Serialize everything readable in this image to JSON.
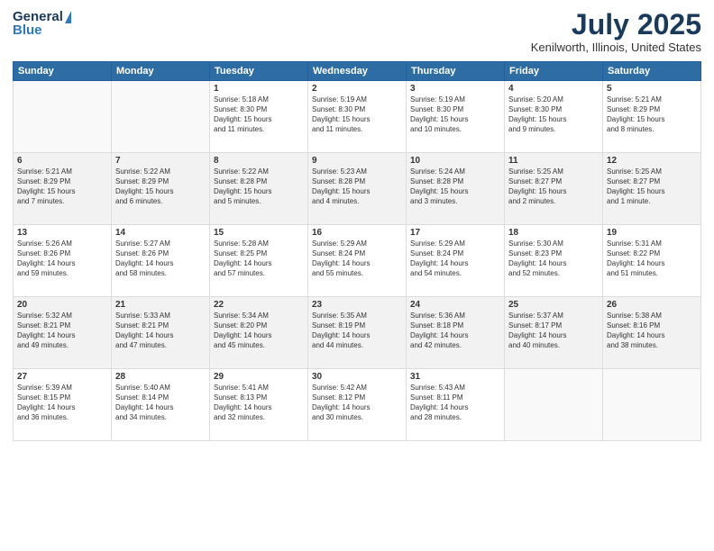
{
  "header": {
    "logo_line1": "General",
    "logo_line2": "Blue",
    "title": "July 2025",
    "subtitle": "Kenilworth, Illinois, United States"
  },
  "weekdays": [
    "Sunday",
    "Monday",
    "Tuesday",
    "Wednesday",
    "Thursday",
    "Friday",
    "Saturday"
  ],
  "weeks": [
    [
      {
        "day": "",
        "content": ""
      },
      {
        "day": "",
        "content": ""
      },
      {
        "day": "1",
        "content": "Sunrise: 5:18 AM\nSunset: 8:30 PM\nDaylight: 15 hours\nand 11 minutes."
      },
      {
        "day": "2",
        "content": "Sunrise: 5:19 AM\nSunset: 8:30 PM\nDaylight: 15 hours\nand 11 minutes."
      },
      {
        "day": "3",
        "content": "Sunrise: 5:19 AM\nSunset: 8:30 PM\nDaylight: 15 hours\nand 10 minutes."
      },
      {
        "day": "4",
        "content": "Sunrise: 5:20 AM\nSunset: 8:30 PM\nDaylight: 15 hours\nand 9 minutes."
      },
      {
        "day": "5",
        "content": "Sunrise: 5:21 AM\nSunset: 8:29 PM\nDaylight: 15 hours\nand 8 minutes."
      }
    ],
    [
      {
        "day": "6",
        "content": "Sunrise: 5:21 AM\nSunset: 8:29 PM\nDaylight: 15 hours\nand 7 minutes."
      },
      {
        "day": "7",
        "content": "Sunrise: 5:22 AM\nSunset: 8:29 PM\nDaylight: 15 hours\nand 6 minutes."
      },
      {
        "day": "8",
        "content": "Sunrise: 5:22 AM\nSunset: 8:28 PM\nDaylight: 15 hours\nand 5 minutes."
      },
      {
        "day": "9",
        "content": "Sunrise: 5:23 AM\nSunset: 8:28 PM\nDaylight: 15 hours\nand 4 minutes."
      },
      {
        "day": "10",
        "content": "Sunrise: 5:24 AM\nSunset: 8:28 PM\nDaylight: 15 hours\nand 3 minutes."
      },
      {
        "day": "11",
        "content": "Sunrise: 5:25 AM\nSunset: 8:27 PM\nDaylight: 15 hours\nand 2 minutes."
      },
      {
        "day": "12",
        "content": "Sunrise: 5:25 AM\nSunset: 8:27 PM\nDaylight: 15 hours\nand 1 minute."
      }
    ],
    [
      {
        "day": "13",
        "content": "Sunrise: 5:26 AM\nSunset: 8:26 PM\nDaylight: 14 hours\nand 59 minutes."
      },
      {
        "day": "14",
        "content": "Sunrise: 5:27 AM\nSunset: 8:26 PM\nDaylight: 14 hours\nand 58 minutes."
      },
      {
        "day": "15",
        "content": "Sunrise: 5:28 AM\nSunset: 8:25 PM\nDaylight: 14 hours\nand 57 minutes."
      },
      {
        "day": "16",
        "content": "Sunrise: 5:29 AM\nSunset: 8:24 PM\nDaylight: 14 hours\nand 55 minutes."
      },
      {
        "day": "17",
        "content": "Sunrise: 5:29 AM\nSunset: 8:24 PM\nDaylight: 14 hours\nand 54 minutes."
      },
      {
        "day": "18",
        "content": "Sunrise: 5:30 AM\nSunset: 8:23 PM\nDaylight: 14 hours\nand 52 minutes."
      },
      {
        "day": "19",
        "content": "Sunrise: 5:31 AM\nSunset: 8:22 PM\nDaylight: 14 hours\nand 51 minutes."
      }
    ],
    [
      {
        "day": "20",
        "content": "Sunrise: 5:32 AM\nSunset: 8:21 PM\nDaylight: 14 hours\nand 49 minutes."
      },
      {
        "day": "21",
        "content": "Sunrise: 5:33 AM\nSunset: 8:21 PM\nDaylight: 14 hours\nand 47 minutes."
      },
      {
        "day": "22",
        "content": "Sunrise: 5:34 AM\nSunset: 8:20 PM\nDaylight: 14 hours\nand 45 minutes."
      },
      {
        "day": "23",
        "content": "Sunrise: 5:35 AM\nSunset: 8:19 PM\nDaylight: 14 hours\nand 44 minutes."
      },
      {
        "day": "24",
        "content": "Sunrise: 5:36 AM\nSunset: 8:18 PM\nDaylight: 14 hours\nand 42 minutes."
      },
      {
        "day": "25",
        "content": "Sunrise: 5:37 AM\nSunset: 8:17 PM\nDaylight: 14 hours\nand 40 minutes."
      },
      {
        "day": "26",
        "content": "Sunrise: 5:38 AM\nSunset: 8:16 PM\nDaylight: 14 hours\nand 38 minutes."
      }
    ],
    [
      {
        "day": "27",
        "content": "Sunrise: 5:39 AM\nSunset: 8:15 PM\nDaylight: 14 hours\nand 36 minutes."
      },
      {
        "day": "28",
        "content": "Sunrise: 5:40 AM\nSunset: 8:14 PM\nDaylight: 14 hours\nand 34 minutes."
      },
      {
        "day": "29",
        "content": "Sunrise: 5:41 AM\nSunset: 8:13 PM\nDaylight: 14 hours\nand 32 minutes."
      },
      {
        "day": "30",
        "content": "Sunrise: 5:42 AM\nSunset: 8:12 PM\nDaylight: 14 hours\nand 30 minutes."
      },
      {
        "day": "31",
        "content": "Sunrise: 5:43 AM\nSunset: 8:11 PM\nDaylight: 14 hours\nand 28 minutes."
      },
      {
        "day": "",
        "content": ""
      },
      {
        "day": "",
        "content": ""
      }
    ]
  ]
}
